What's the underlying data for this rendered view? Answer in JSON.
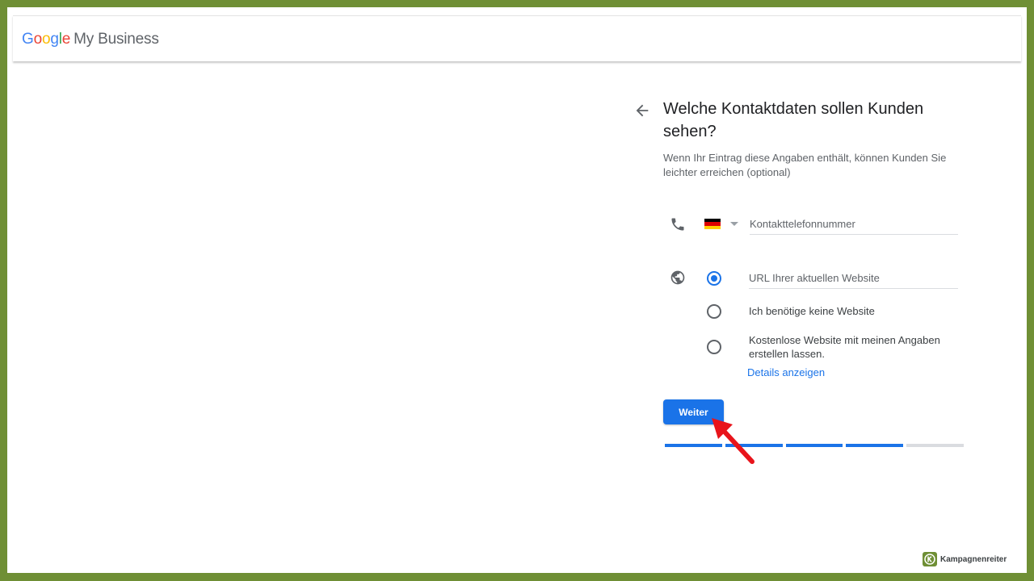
{
  "header": {
    "brand": {
      "g1": "G",
      "o1": "o",
      "o2": "o",
      "g2": "g",
      "l": "l",
      "e": "e",
      "product": "My Business"
    }
  },
  "form": {
    "title": "Welche Kontaktdaten sollen Kunden sehen?",
    "subtitle": "Wenn Ihr Eintrag diese Angaben enthält, können Kunden Sie leichter erreichen (optional)",
    "phone": {
      "country_flag": "Germany",
      "placeholder": "Kontakttelefonnummer",
      "value": ""
    },
    "website": {
      "options": [
        {
          "label": "URL Ihrer aktuellen Website",
          "selected": true
        },
        {
          "label": "Ich benötige keine Website",
          "selected": false
        },
        {
          "label": "Kostenlose Website mit meinen Angaben erstellen lassen.",
          "selected": false
        }
      ],
      "url_placeholder": "URL Ihrer aktuellen Website",
      "url_value": "",
      "details_link": "Details anzeigen"
    },
    "next_button": "Weiter",
    "progress": {
      "steps_total": 5,
      "steps_done": 4
    }
  },
  "watermark": {
    "text": "Kampagnenreiter",
    "logo_letter": "K"
  },
  "colors": {
    "accent": "#1a73e8",
    "frame": "#6f8f35",
    "annotation_arrow": "#e8141b"
  }
}
